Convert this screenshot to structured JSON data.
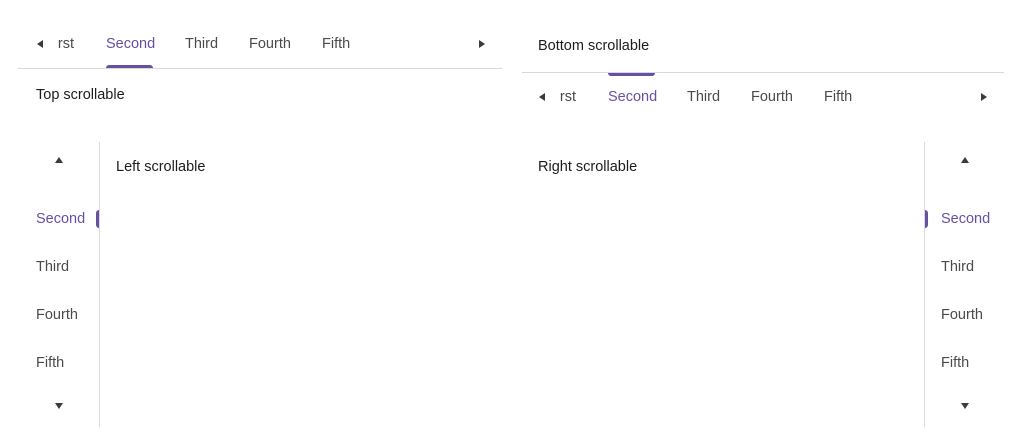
{
  "top_scrollable": {
    "tabs": [
      "First",
      "Second",
      "Third",
      "Fourth",
      "Fifth"
    ],
    "partial_tab_text": "rst",
    "active_tab": "Second",
    "content": "Top scrollable"
  },
  "bottom_scrollable": {
    "tabs": [
      "First",
      "Second",
      "Third",
      "Fourth",
      "Fifth"
    ],
    "partial_tab_text": "rst",
    "active_tab": "Second",
    "content": "Bottom scrollable"
  },
  "left_scrollable": {
    "tabs": [
      "Second",
      "Third",
      "Fourth",
      "Fifth"
    ],
    "active_tab": "Second",
    "content": "Left scrollable"
  },
  "right_scrollable": {
    "tabs": [
      "Second",
      "Third",
      "Fourth",
      "Fifth"
    ],
    "active_tab": "Second",
    "content": "Right scrollable"
  },
  "colors": {
    "accent": "#6750a4",
    "divider": "#d9d9d9",
    "tab_text": "#4a4a4a"
  }
}
